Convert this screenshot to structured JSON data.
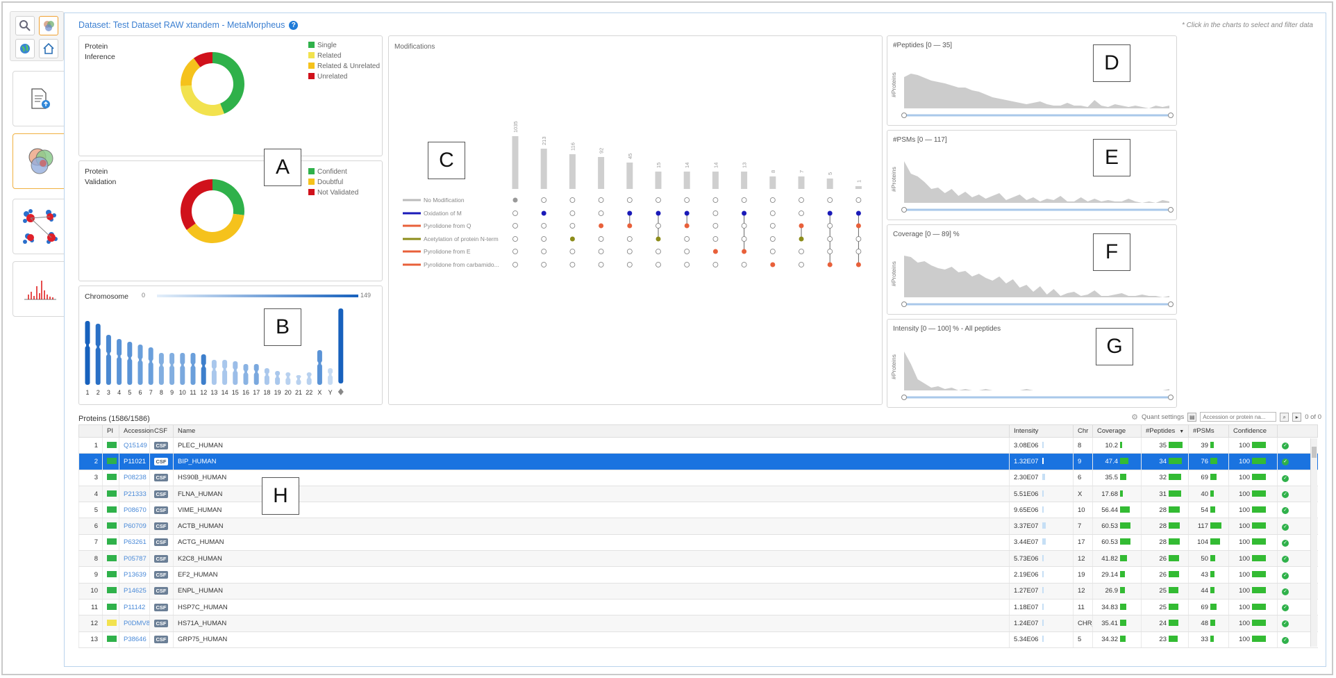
{
  "dataset_title": "Dataset: Test Dataset RAW xtandem - MetaMorpheus",
  "hint": "* Click in the charts to select and filter data",
  "labels": {
    "a": "A",
    "b": "B",
    "c": "C",
    "d": "D",
    "e": "E",
    "f": "F",
    "g": "G",
    "h": "H"
  },
  "protein_inference": {
    "title": "Protein\nInference",
    "legend": [
      "Single",
      "Related",
      "Related & Unrelated",
      "Unrelated"
    ],
    "colors": [
      "#2fb14a",
      "#f2e24e",
      "#f5c21c",
      "#d0111b"
    ],
    "values": [
      44,
      30,
      16,
      10
    ]
  },
  "protein_validation": {
    "title": "Protein\nValidation",
    "legend": [
      "Confident",
      "Doubtful",
      "Not Validated"
    ],
    "colors": [
      "#2fb14a",
      "#f5c21c",
      "#d0111b"
    ],
    "values": [
      27,
      38,
      35
    ]
  },
  "chromosome": {
    "title": "Chromosome",
    "range_min": "0",
    "range_max": "149",
    "names": [
      "1",
      "2",
      "3",
      "4",
      "5",
      "6",
      "7",
      "8",
      "9",
      "10",
      "11",
      "12",
      "13",
      "14",
      "15",
      "16",
      "17",
      "18",
      "19",
      "20",
      "21",
      "22",
      "X",
      "Y"
    ]
  },
  "modifications": {
    "title": "Modifications",
    "names": [
      "No Modification",
      "Oxidation of M",
      "Pyrolidone from Q",
      "Acetylation of protein N-term",
      "Pyrolidone from E",
      "Pyrolidone from carbamido..."
    ],
    "colors": [
      "#bbbbbb",
      "#1a1ab8",
      "#e8603a",
      "#8c8c1a",
      "#e8603a",
      "#e8603a"
    ],
    "counts": [
      "1035",
      "213",
      "116",
      "92",
      "45",
      "15",
      "14",
      "14",
      "13",
      "8",
      "7",
      "5",
      "1",
      "1",
      "1",
      "1",
      "1"
    ]
  },
  "mini_charts": [
    {
      "title": "#Peptides [0 — 35]",
      "ylabel": "#Proteins"
    },
    {
      "title": "#PSMs [0 — 117]",
      "ylabel": "#Proteins"
    },
    {
      "title": "Coverage [0 — 89] %",
      "ylabel": "#Proteins"
    },
    {
      "title": "Intensity [0 — 100] % - All peptides",
      "ylabel": "#Proteins"
    }
  ],
  "table": {
    "title": "Proteins (1586/1586)",
    "quant_settings": "Quant settings",
    "search_placeholder": "Accession or protein na...",
    "paging": "0 of 0",
    "headers": [
      "",
      "PI",
      "Accession",
      "CSF",
      "Name",
      "Intensity",
      "Chr",
      "Coverage",
      "#Peptides",
      "#PSMs",
      "Confidence",
      ""
    ],
    "sort_arrow": "▼",
    "rows": [
      {
        "n": "1",
        "acc": "Q15149",
        "name": "PLEC_HUMAN",
        "int": "3.08E06",
        "chr": "8",
        "cov": "10.2",
        "pep": "35",
        "psm": "39",
        "conf": "100"
      },
      {
        "n": "2",
        "acc": "P11021",
        "name": "BIP_HUMAN",
        "int": "1.32E07",
        "chr": "9",
        "cov": "47.4",
        "pep": "34",
        "psm": "76",
        "conf": "100"
      },
      {
        "n": "3",
        "acc": "P08238",
        "name": "HS90B_HUMAN",
        "int": "2.30E07",
        "chr": "6",
        "cov": "35.5",
        "pep": "32",
        "psm": "69",
        "conf": "100"
      },
      {
        "n": "4",
        "acc": "P21333",
        "name": "FLNA_HUMAN",
        "int": "5.51E06",
        "chr": "X",
        "cov": "17.68",
        "pep": "31",
        "psm": "40",
        "conf": "100"
      },
      {
        "n": "5",
        "acc": "P08670",
        "name": "VIME_HUMAN",
        "int": "9.65E06",
        "chr": "10",
        "cov": "56.44",
        "pep": "28",
        "psm": "54",
        "conf": "100"
      },
      {
        "n": "6",
        "acc": "P60709",
        "name": "ACTB_HUMAN",
        "int": "3.37E07",
        "chr": "7",
        "cov": "60.53",
        "pep": "28",
        "psm": "117",
        "conf": "100"
      },
      {
        "n": "7",
        "acc": "P63261",
        "name": "ACTG_HUMAN",
        "int": "3.44E07",
        "chr": "17",
        "cov": "60.53",
        "pep": "28",
        "psm": "104",
        "conf": "100"
      },
      {
        "n": "8",
        "acc": "P05787",
        "name": "K2C8_HUMAN",
        "int": "5.73E06",
        "chr": "12",
        "cov": "41.82",
        "pep": "26",
        "psm": "50",
        "conf": "100"
      },
      {
        "n": "9",
        "acc": "P13639",
        "name": "EF2_HUMAN",
        "int": "2.19E06",
        "chr": "19",
        "cov": "29.14",
        "pep": "26",
        "psm": "43",
        "conf": "100"
      },
      {
        "n": "10",
        "acc": "P14625",
        "name": "ENPL_HUMAN",
        "int": "1.27E07",
        "chr": "12",
        "cov": "26.9",
        "pep": "25",
        "psm": "44",
        "conf": "100"
      },
      {
        "n": "11",
        "acc": "P11142",
        "name": "HSP7C_HUMAN",
        "int": "1.18E07",
        "chr": "11",
        "cov": "34.83",
        "pep": "25",
        "psm": "69",
        "conf": "100"
      },
      {
        "n": "12",
        "acc": "P0DMV8",
        "name": "HS71A_HUMAN",
        "int": "1.24E07",
        "chr": "CHR_H",
        "cov": "35.41",
        "pep": "24",
        "psm": "48",
        "conf": "100"
      },
      {
        "n": "13",
        "acc": "P38646",
        "name": "GRP75_HUMAN",
        "int": "5.34E06",
        "chr": "5",
        "cov": "34.32",
        "pep": "23",
        "psm": "33",
        "conf": "100"
      }
    ]
  }
}
